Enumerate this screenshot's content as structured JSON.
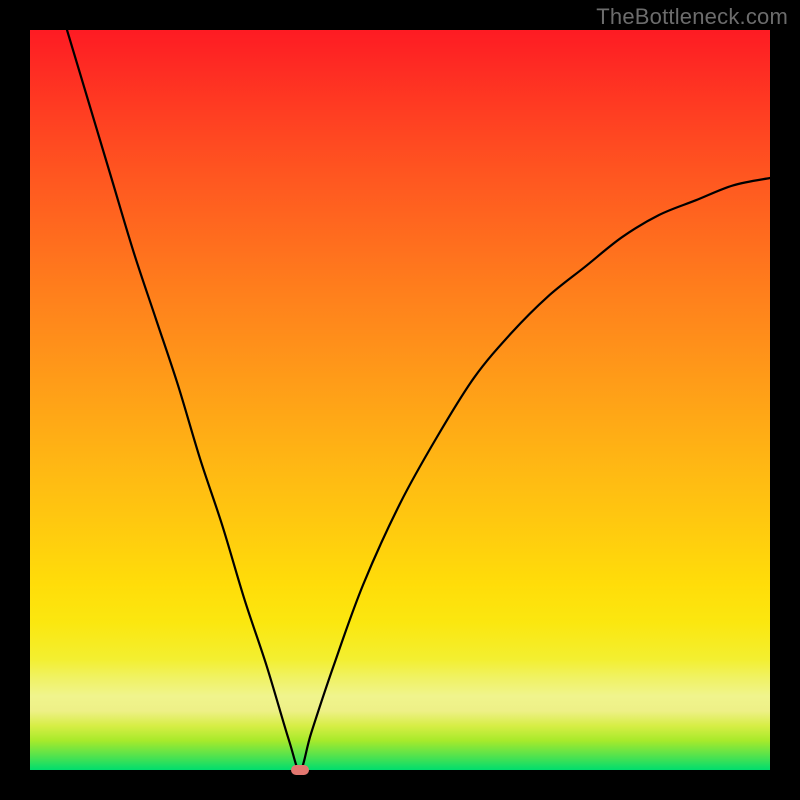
{
  "watermark": "TheBottleneck.com",
  "colors": {
    "frame": "#000000",
    "curve": "#000000",
    "dot": "#e2766f",
    "watermark": "#6c6c6c"
  },
  "chart_data": {
    "type": "line",
    "title": "",
    "xlabel": "",
    "ylabel": "",
    "xlim": [
      0,
      100
    ],
    "ylim": [
      0,
      100
    ],
    "grid": false,
    "legend": false,
    "annotations": [],
    "series": [
      {
        "name": "bottleneck-curve",
        "x": [
          5,
          8,
          11,
          14,
          17,
          20,
          23,
          26,
          29,
          32,
          35,
          36.5,
          38,
          41,
          45,
          50,
          55,
          60,
          65,
          70,
          75,
          80,
          85,
          90,
          95,
          100
        ],
        "y": [
          100,
          90,
          80,
          70,
          61,
          52,
          42,
          33,
          23,
          14,
          4,
          0,
          5,
          14,
          25,
          36,
          45,
          53,
          59,
          64,
          68,
          72,
          75,
          77,
          79,
          80
        ]
      }
    ],
    "marker": {
      "x": 36.5,
      "y": 0
    }
  }
}
